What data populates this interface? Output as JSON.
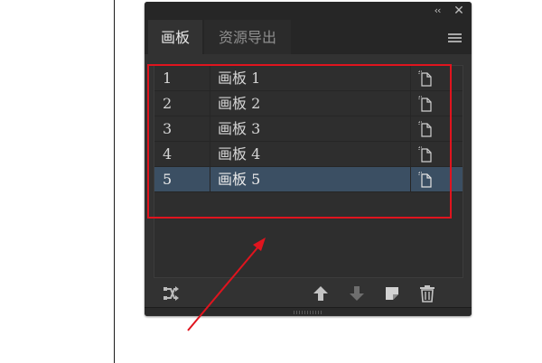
{
  "panel": {
    "title_controls": {
      "collapse_glyph": "‹‹",
      "close_glyph": "✕"
    },
    "tabs": [
      {
        "label": "画板",
        "active": true
      },
      {
        "label": "资源导出",
        "active": false
      }
    ],
    "menu_icon": "hamburger-menu-icon",
    "artboards": {
      "rows": [
        {
          "number": "1",
          "name": "画板 1",
          "selected": false
        },
        {
          "number": "2",
          "name": "画板 2",
          "selected": false
        },
        {
          "number": "3",
          "name": "画板 3",
          "selected": false
        },
        {
          "number": "4",
          "name": "画板 4",
          "selected": false
        },
        {
          "number": "5",
          "name": "画板 5",
          "selected": true
        }
      ],
      "row_icon": "artboard-options-icon"
    },
    "footer_buttons": [
      {
        "name": "rearrange-icon"
      },
      {
        "name": "move-up-icon"
      },
      {
        "name": "move-down-icon"
      },
      {
        "name": "new-artboard-icon"
      },
      {
        "name": "delete-icon"
      }
    ]
  },
  "colors": {
    "panel_bg": "#323232",
    "tabstrip_bg": "#262626",
    "selected_row": "#3b4f63",
    "annotation_red": "#e0141e"
  }
}
